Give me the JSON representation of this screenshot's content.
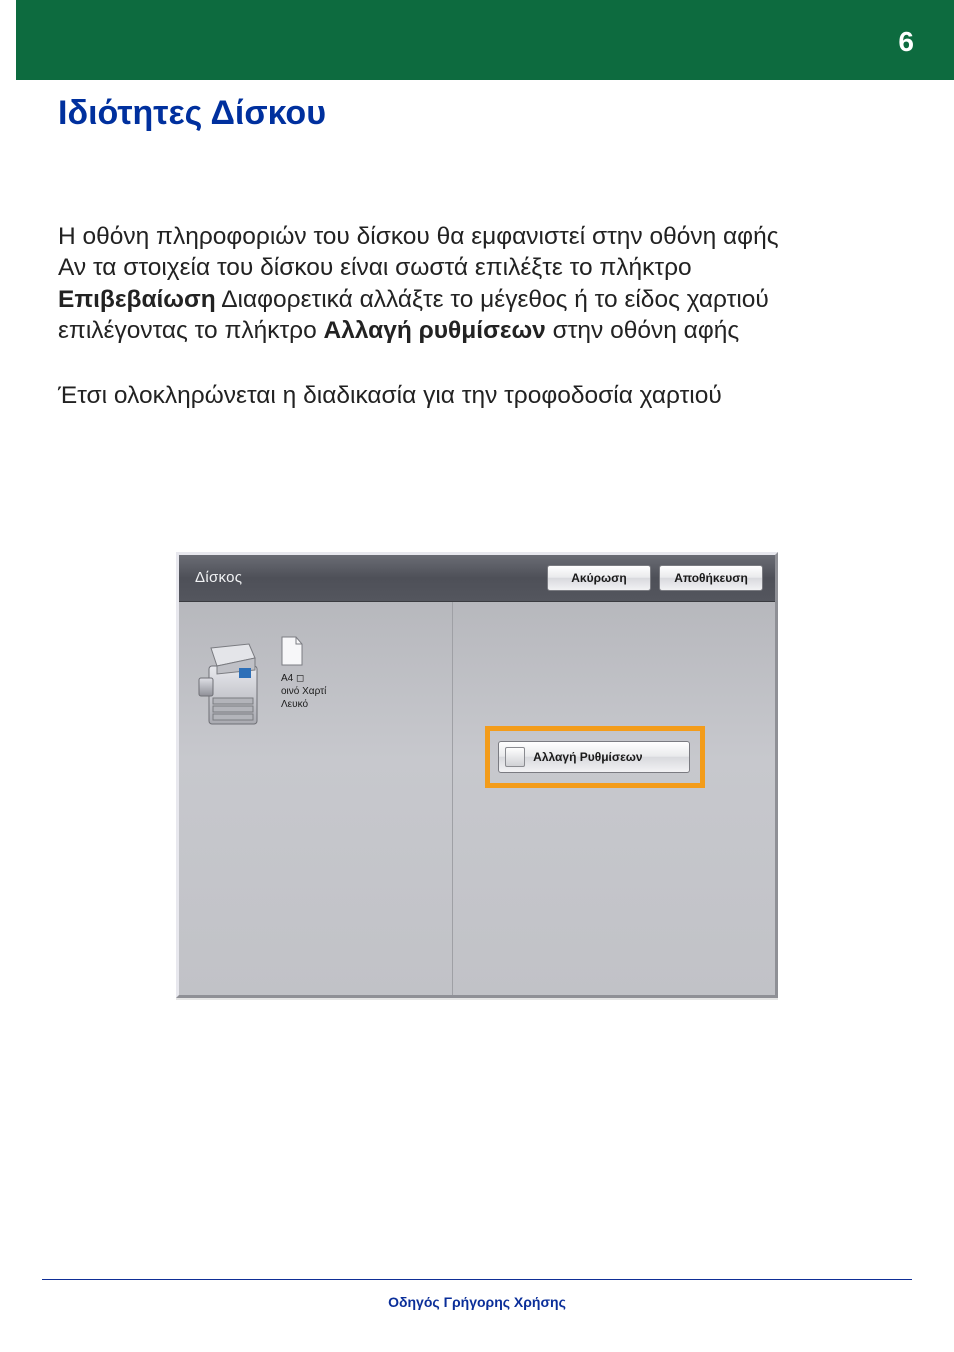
{
  "page_number": "6",
  "title": "Ιδιότητες Δίσκου",
  "paragraph1": {
    "line1": "Η οθόνη πληροφοριών του δίσκου θα εμφανιστεί στην οθόνη αφής",
    "line2_pre": "Αν τα στοιχεία του δίσκου είναι σωστά επιλέξτε το πλήκτρο",
    "bold1": "Επιβεβαίωση",
    "line3_mid": "  Διαφορετικά  αλλάξτε το μέγεθος ή το είδος χαρτιού",
    "line4_pre": "επιλέγοντας το πλήκτρο ",
    "bold2": "Αλλαγή ρυθμίσεων",
    "line4_post": " στην οθόνη αφής"
  },
  "paragraph2": "Έτσι ολοκληρώνεται η διαδικασία για την τροφοδοσία χαρτιού",
  "panel": {
    "title": "Δίσκος",
    "cancel": "Ακύρωση",
    "save": "Αποθήκευση",
    "paper_size": "A4",
    "paper_type": "οινό Χαρτί",
    "paper_color": "Λευκό",
    "change_settings": "Αλλαγή Ρυθμίσεων"
  },
  "footer": "Οδηγός Γρήγορης Χρήσης"
}
